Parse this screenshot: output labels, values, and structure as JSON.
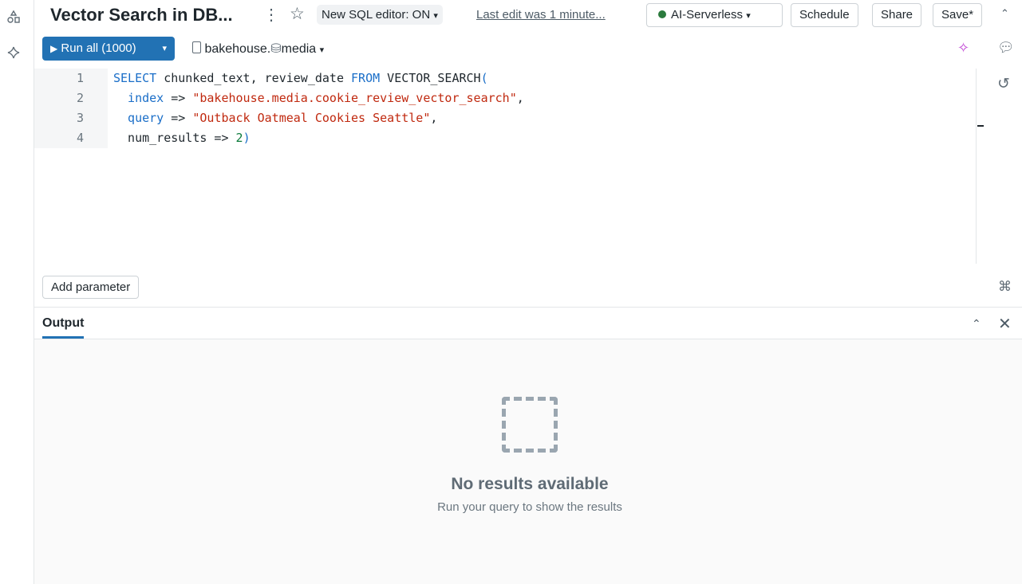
{
  "header": {
    "title": "Vector Search in DB...",
    "editor_toggle": "New SQL editor: ON",
    "last_edit": "Last edit was 1 minute...",
    "compute": "AI-Serverless",
    "compute_status_color": "#2b7a3d",
    "schedule": "Schedule",
    "share": "Share",
    "save": "Save*"
  },
  "toolbar": {
    "run_label": "Run all",
    "run_limit": "(1000)",
    "catalog": "bakehouse",
    "separator": ".",
    "schema": "media"
  },
  "editor": {
    "line_numbers": [
      "1",
      "2",
      "3",
      "4"
    ]
  },
  "code": {
    "l1a": "SELECT",
    "l1b": " chunked_text, review_date ",
    "l1c": "FROM",
    "l1d": " VECTOR_SEARCH",
    "l1e": "(",
    "l2a": "  index",
    "l2b": " => ",
    "l2c": "\"bakehouse.media.cookie_review_vector_search\"",
    "l2d": ",",
    "l3a": "  query",
    "l3b": " => ",
    "l3c": "\"Outback Oatmeal Cookies Seattle\"",
    "l3d": ",",
    "l4a": "  num_results => ",
    "l4b": "2",
    "l4c": ")"
  },
  "params": {
    "add": "Add parameter"
  },
  "output": {
    "tab": "Output",
    "empty_title": "No results available",
    "empty_subtitle": "Run your query to show the results"
  }
}
